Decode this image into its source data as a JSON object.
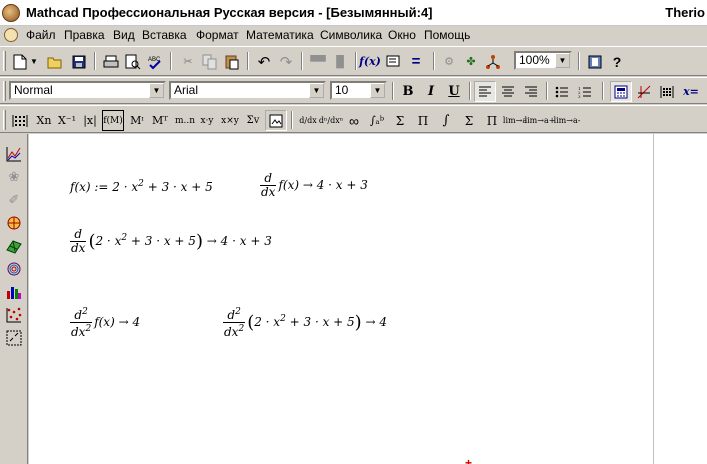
{
  "window": {
    "title": "Mathcad Профессиональная Русская версия - [Безымянный:4]",
    "title_right": "Therio"
  },
  "menu": [
    {
      "label": "Файл"
    },
    {
      "label": "Правка"
    },
    {
      "label": "Вид"
    },
    {
      "label": "Вставка"
    },
    {
      "label": "Формат"
    },
    {
      "label": "Математика"
    },
    {
      "label": "Символика"
    },
    {
      "label": "Окно"
    },
    {
      "label": "Помощь"
    }
  ],
  "toolbar_standard": {
    "zoom_value": "100%",
    "calc_label": "f(x)",
    "equals_label": "="
  },
  "toolbar_formatting": {
    "style_value": "Normal",
    "font_value": "Arial",
    "size_value": "10",
    "bold_label": "B",
    "italic_label": "I",
    "underline_label": "U",
    "xeq_label": "x="
  },
  "toolbar_math": {
    "matrix_labels": [
      "Xn",
      "X⁻¹",
      "|x|",
      "f(M)",
      "Mᶦ",
      "Mᵀ",
      "m..n",
      "x·y",
      "x×y",
      "Σv"
    ],
    "calculus_labels": [
      "d/dx",
      "dⁿ/dxⁿ",
      "∞",
      "∫ₐᵇ",
      "Σ",
      "Π",
      "∫",
      "Σ",
      "Π",
      "lim→a",
      "lim→a+",
      "lim→a-"
    ]
  },
  "worksheet": {
    "expr1_lhs": "f(x) := 2 · x",
    "expr1_rhs": " + 3 · x + 5",
    "expr2_func": "f(x) → 4 · x + 3",
    "expr3_body": "2 · x",
    "expr3_rest": " + 3 · x + 5",
    "expr3_result": "→ 4 · x + 3",
    "expr4_func": "f(x) → 4",
    "expr5_body": "2 · x",
    "expr5_rest": " + 3 · x + 5",
    "expr5_result": "→ 4",
    "d_num": "d",
    "d_den": "dx",
    "d2_num": "d",
    "d2_den": "dx",
    "sup2": "2"
  }
}
